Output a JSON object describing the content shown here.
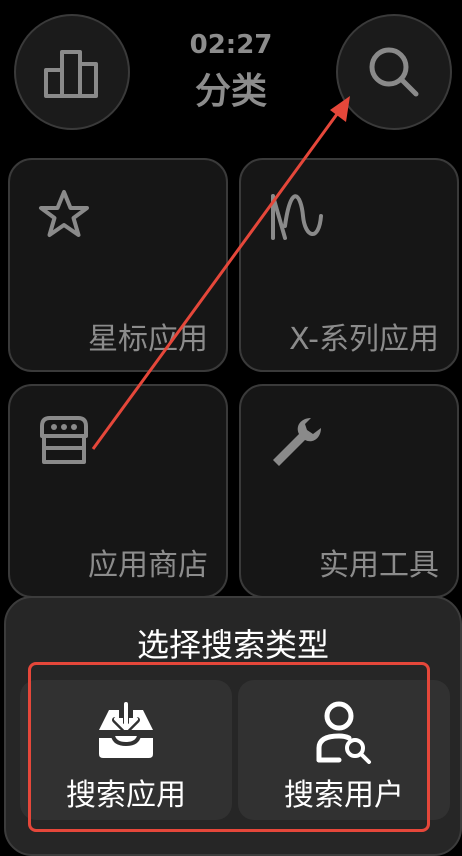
{
  "header": {
    "time": "02:27",
    "title": "分类"
  },
  "tiles": [
    {
      "label": "星标应用",
      "icon": "star-icon"
    },
    {
      "label": "X-系列应用",
      "icon": "waveform-icon"
    },
    {
      "label": "应用商店",
      "icon": "store-icon"
    },
    {
      "label": "实用工具",
      "icon": "wrench-icon"
    }
  ],
  "sheet": {
    "title": "选择搜索类型",
    "options": [
      {
        "label": "搜索应用",
        "icon": "download-tray-icon"
      },
      {
        "label": "搜索用户",
        "icon": "user-search-icon"
      }
    ]
  },
  "colors": {
    "annotation": "#e5473a",
    "background": "#000000",
    "tile": "#161616",
    "sheet": "#262626"
  }
}
